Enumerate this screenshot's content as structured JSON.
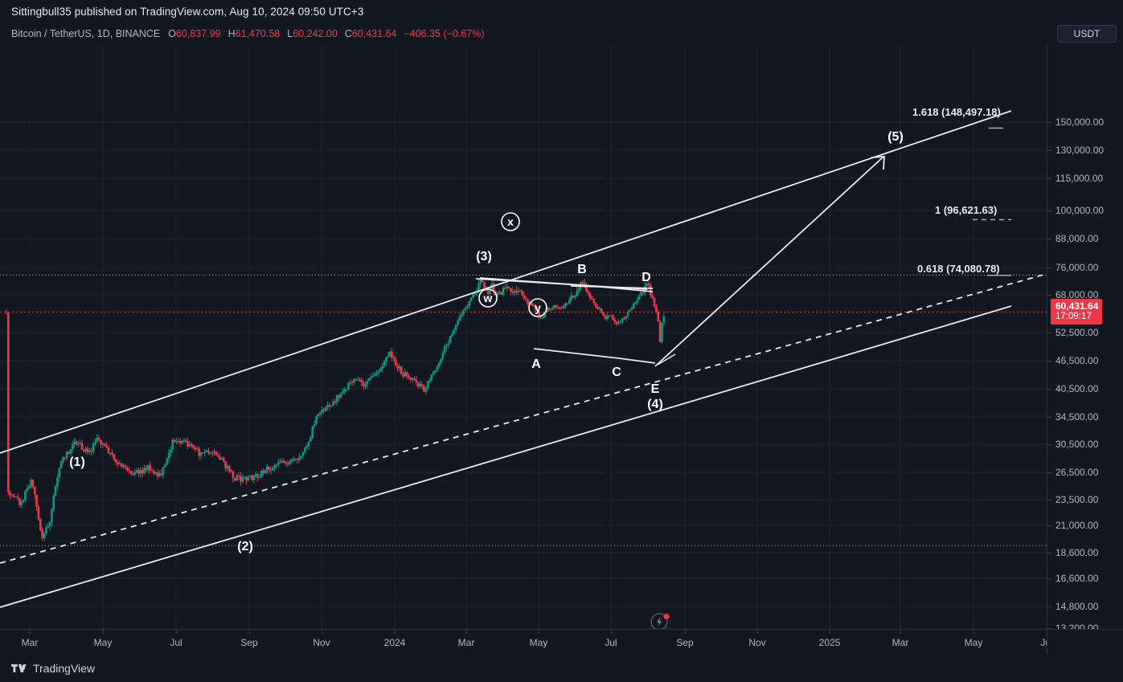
{
  "publisher": {
    "text": "Sittingbull35 published on TradingView.com, Aug 10, 2024 09:50 UTC+3"
  },
  "legend": {
    "symbol": "Bitcoin / TetherUS, 1D, BINANCE",
    "open_label": "O",
    "open_value": "60,837.99",
    "high_label": "H",
    "high_value": "61,470.58",
    "low_label": "L",
    "low_value": "60,242.00",
    "close_label": "C",
    "close_value": "60,431.64",
    "change": "−406.35 (−0.67%)"
  },
  "currency_button": {
    "label": "USDT"
  },
  "footer": {
    "brand": "TradingView"
  },
  "last_price": {
    "value": "60,431.64",
    "countdown": "17:09:17"
  },
  "chart_data": {
    "type": "line",
    "title": "Bitcoin / TetherUS, 1D, BINANCE",
    "xlabel": "",
    "ylabel": "USDT",
    "grid": true,
    "legend_position": "top-left",
    "ylim": [
      13200,
      158000
    ],
    "y_scale": "log",
    "y_ticks": [
      "150,000.00",
      "130,000.00",
      "115,000.00",
      "100,000.00",
      "88,000.00",
      "76,000.00",
      "68,000.00",
      "52,500.00",
      "46,500.00",
      "40,500.00",
      "34,500.00",
      "30,500.00",
      "26,500.00",
      "23,500.00",
      "21,000.00",
      "18,600.00",
      "16,600.00",
      "14,800.00",
      "13,200.00"
    ],
    "y_tick_values": [
      150000,
      130000,
      115000,
      100000,
      88000,
      76000,
      68000,
      52500,
      46500,
      40500,
      34500,
      30500,
      26500,
      23500,
      21000,
      18600,
      16600,
      14800,
      13200
    ],
    "x_ticks": [
      "Mar",
      "May",
      "Jul",
      "Sep",
      "Nov",
      "2024",
      "Mar",
      "May",
      "Jul",
      "Sep",
      "Nov",
      "2025",
      "Mar",
      "May",
      "Jul"
    ],
    "ohlc": {
      "open": 60837.99,
      "high": 61470.58,
      "low": 60242.0,
      "close": 60431.64,
      "change_abs": -406.35,
      "change_pct": -0.67
    },
    "fib_levels": [
      {
        "label": "1.618 (148,497.18)",
        "ratio": 1.618,
        "price": 148497.18
      },
      {
        "label": "1 (96,621.63)",
        "ratio": 1.0,
        "price": 96621.63
      },
      {
        "label": "0.618 (74,080.78)",
        "ratio": 0.618,
        "price": 74080.78
      }
    ],
    "wave_labels": [
      {
        "text": "(1)",
        "kind": "impulse"
      },
      {
        "text": "(2)",
        "kind": "impulse"
      },
      {
        "text": "(3)",
        "kind": "impulse"
      },
      {
        "text": "(4)",
        "kind": "impulse"
      },
      {
        "text": "(5)",
        "kind": "impulse"
      },
      {
        "text": "w",
        "kind": "circled"
      },
      {
        "text": "x",
        "kind": "circled"
      },
      {
        "text": "y",
        "kind": "circled"
      },
      {
        "text": "A",
        "kind": "triangle"
      },
      {
        "text": "B",
        "kind": "triangle"
      },
      {
        "text": "C",
        "kind": "triangle"
      },
      {
        "text": "D",
        "kind": "triangle"
      },
      {
        "text": "E",
        "kind": "triangle"
      }
    ],
    "colors": {
      "background": "#131722",
      "grid": "#1f2533",
      "up_candle": "#089981",
      "down_candle": "#f23645",
      "text": "#b2b5be",
      "drawing": "#e8eaee",
      "last_price": "#f23645"
    }
  },
  "icons": {
    "alert": "lightning-bolt-icon",
    "currency_chevron": "none"
  }
}
